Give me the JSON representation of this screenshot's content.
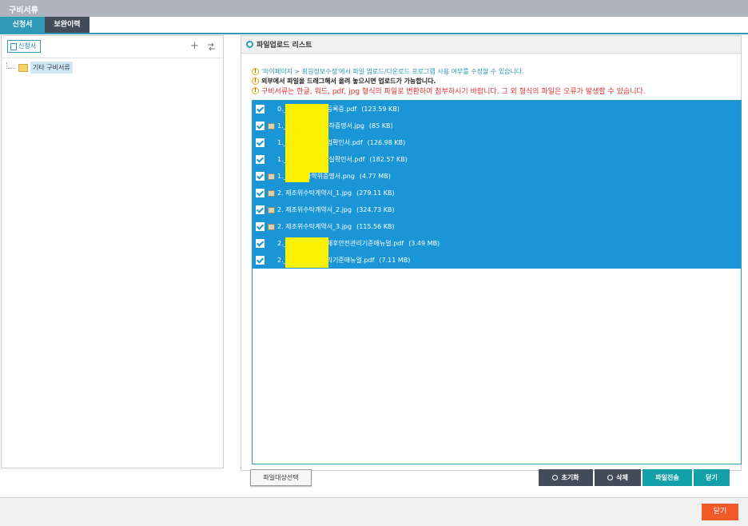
{
  "window": {
    "title": "구비서류"
  },
  "tabs": [
    {
      "label": "신청서",
      "active": true
    },
    {
      "label": "보완이력",
      "active": false
    }
  ],
  "left_panel": {
    "apply_button": "신청서",
    "tree": [
      {
        "label": "기타 구비서류",
        "icon": "folder-icon",
        "selected": true
      }
    ]
  },
  "right_panel": {
    "header": "파일업로드 리스트",
    "notices": [
      "'마이페이지 > 회원정보수정'에서 파일 업로드/다운로드 프로그램 사용 여부를 수정할 수 있습니다.",
      "외부에서 파일을 드래그해서 올려 놓으시면 업로드가 가능합니다.",
      "구비서류는 한글, 워드, pdf, jpg 형식의 파일로 변환하여 첨부하시기 바랍니다. 그 외 형식의 파일은 오류가 발생할 수 있습니다."
    ],
    "files": [
      {
        "name": "0.________사업자등록증.pdf",
        "size": "(123.59 KB)",
        "checked": true,
        "thumb": false
      },
      {
        "name": "1.________10인이하증명서.jpg",
        "size": "(85 KB)",
        "checked": true,
        "thumb": true
      },
      {
        "name": "1.________중소기업확인서.pdf",
        "size": "(126.98 KB)",
        "checked": true,
        "thumb": false
      },
      {
        "name": "1._____건강보험득실확인서.pdf",
        "size": "(182.57 KB)",
        "checked": true,
        "thumb": false
      },
      {
        "name": "1._____학사학위증명서.png",
        "size": "(4.77 MB)",
        "checked": true,
        "thumb": true
      },
      {
        "name": "2. 제조위수탁계약서_1.jpg",
        "size": "(279.11 KB)",
        "checked": true,
        "thumb": true
      },
      {
        "name": "2. 제조위수탁계약서_2.jpg",
        "size": "(324.73 KB)",
        "checked": true,
        "thumb": true
      },
      {
        "name": "2. 제조위수탁계약서_3.jpg",
        "size": "(115.56 KB)",
        "checked": true,
        "thumb": true
      },
      {
        "name": "2.________책임판매후안전관리기준매뉴얼.pdf",
        "size": "(3.49 MB)",
        "checked": true,
        "thumb": false
      },
      {
        "name": "2.________품질관리기준매뉴얼.pdf",
        "size": "(7.11 MB)",
        "checked": true,
        "thumb": false
      }
    ]
  },
  "buttons": {
    "select_files": "파일대상선택",
    "reset": "초기화",
    "delete": "삭제",
    "send": "파일전송",
    "close": "닫기",
    "footer_close": "닫기"
  },
  "colors": {
    "accent": "#2e9ab8",
    "selection": "#1a95d6",
    "dark_button": "#434d5a",
    "teal_button": "#14a0a8",
    "close_button": "#f05a28"
  }
}
